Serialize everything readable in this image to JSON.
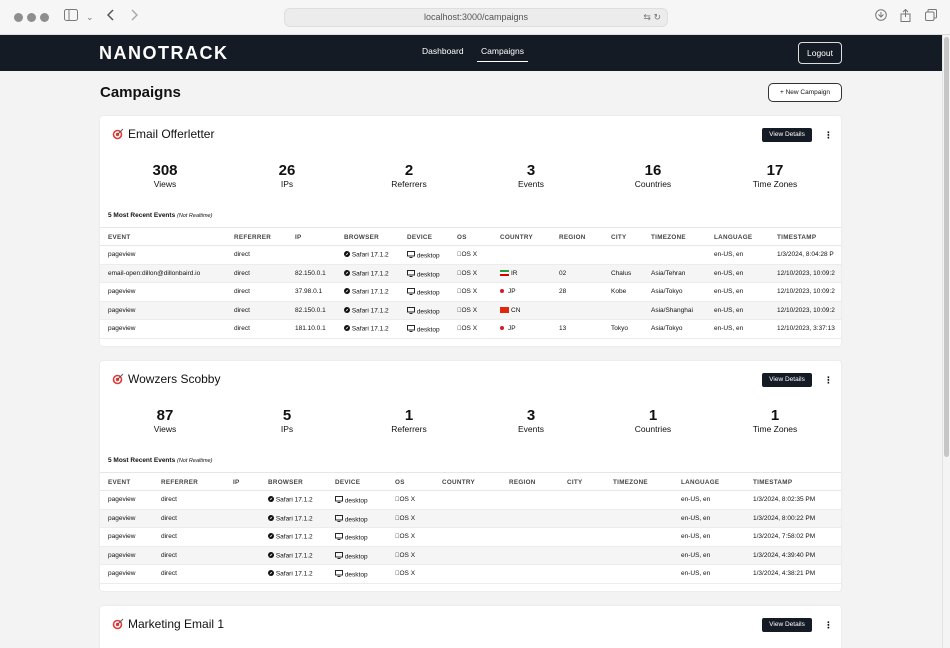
{
  "browser": {
    "url": "localhost:3000/campaigns"
  },
  "nav": {
    "logo": "NANOTRACK",
    "links": [
      "Dashboard",
      "Campaigns"
    ],
    "logout": "Logout"
  },
  "page": {
    "title": "Campaigns",
    "new_campaign": "+ New Campaign"
  },
  "common": {
    "view_details": "View Details",
    "kebab": "⋮",
    "recent_label": "5 Most Recent Events",
    "recent_note": "(Not Realtime)",
    "stat_labels": [
      "Views",
      "IPs",
      "Referrers",
      "Events",
      "Countries",
      "Time Zones"
    ],
    "columns": [
      "EVENT",
      "REFERRER",
      "IP",
      "BROWSER",
      "DEVICE",
      "OS",
      "COUNTRY",
      "REGION",
      "CITY",
      "TIMEZONE",
      "LANGUAGE",
      "TIMESTAMP"
    ]
  },
  "campaigns": [
    {
      "name": "Email Offerletter",
      "stats": [
        "308",
        "26",
        "2",
        "3",
        "16",
        "17"
      ],
      "rows": [
        [
          "pageview",
          "direct",
          "",
          "Safari 17.1.2",
          "desktop",
          "OS X",
          "",
          "",
          "",
          "",
          "en-US, en",
          "1/3/2024, 8:04:28 P"
        ],
        [
          "email-open:dillon@dillonbaird.io",
          "direct",
          "82.150.0.1",
          "Safari 17.1.2",
          "desktop",
          "OS X",
          "IR",
          "02",
          "Chalus",
          "Asia/Tehran",
          "en-US, en",
          "12/10/2023, 10:09:2"
        ],
        [
          "pageview",
          "direct",
          "37.98.0.1",
          "Safari 17.1.2",
          "desktop",
          "OS X",
          "JP",
          "28",
          "Kobe",
          "Asia/Tokyo",
          "en-US, en",
          "12/10/2023, 10:09:2"
        ],
        [
          "pageview",
          "direct",
          "82.150.0.1",
          "Safari 17.1.2",
          "desktop",
          "OS X",
          "CN",
          "",
          "",
          "Asia/Shanghai",
          "en-US, en",
          "12/10/2023, 10:09:2"
        ],
        [
          "pageview",
          "direct",
          "181.10.0.1",
          "Safari 17.1.2",
          "desktop",
          "OS X",
          "JP",
          "13",
          "Tokyo",
          "Asia/Tokyo",
          "en-US, en",
          "12/10/2023, 3:37:13"
        ]
      ]
    },
    {
      "name": "Wowzers Scobby",
      "stats": [
        "87",
        "5",
        "1",
        "3",
        "1",
        "1"
      ],
      "rows": [
        [
          "pageview",
          "direct",
          "",
          "Safari 17.1.2",
          "desktop",
          "OS X",
          "",
          "",
          "",
          "",
          "en-US, en",
          "1/3/2024, 8:02:35 PM"
        ],
        [
          "pageview",
          "direct",
          "",
          "Safari 17.1.2",
          "desktop",
          "OS X",
          "",
          "",
          "",
          "",
          "en-US, en",
          "1/3/2024, 8:00:22 PM"
        ],
        [
          "pageview",
          "direct",
          "",
          "Safari 17.1.2",
          "desktop",
          "OS X",
          "",
          "",
          "",
          "",
          "en-US, en",
          "1/3/2024, 7:58:02 PM"
        ],
        [
          "pageview",
          "direct",
          "",
          "Safari 17.1.2",
          "desktop",
          "OS X",
          "",
          "",
          "",
          "",
          "en-US, en",
          "1/3/2024, 4:39:40 PM"
        ],
        [
          "pageview",
          "direct",
          "",
          "Safari 17.1.2",
          "desktop",
          "OS X",
          "",
          "",
          "",
          "",
          "en-US, en",
          "1/3/2024, 4:38:21 PM"
        ]
      ]
    },
    {
      "name": "Marketing Email 1"
    }
  ],
  "icons": {
    "traffic": "window-control-icon",
    "sidebar": "sidebar-icon",
    "back": "back-arrow-icon",
    "forward": "forward-arrow-icon",
    "download": "download-icon",
    "share": "share-icon",
    "tabs": "tabs-icon",
    "campaign": "target-icon",
    "browser": "safari-icon",
    "device": "desktop-icon",
    "os": "apple-icon"
  }
}
